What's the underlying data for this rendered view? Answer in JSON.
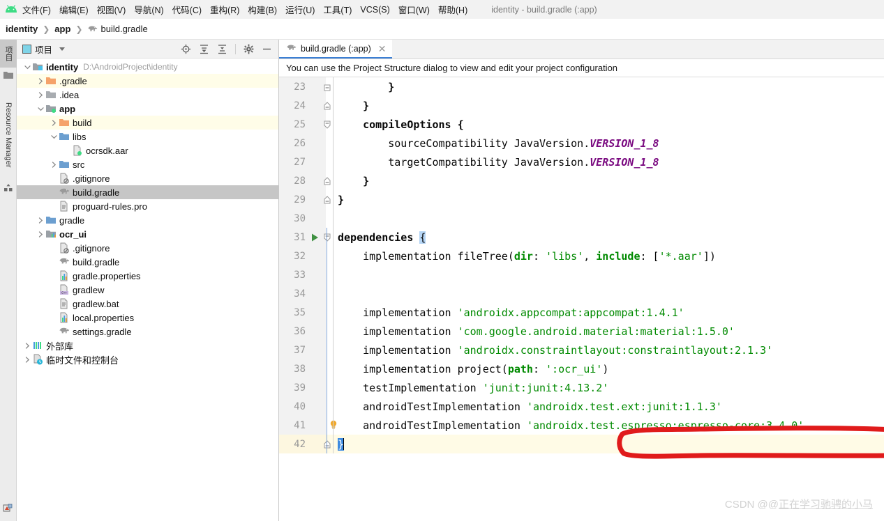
{
  "window": {
    "title": "identity - build.gradle (:app)",
    "accent_color": "#00b8cc"
  },
  "menubar": {
    "logo_icon": "android-logo-icon",
    "items": [
      {
        "label": "文件(F)",
        "name": "menu-file"
      },
      {
        "label": "编辑(E)",
        "name": "menu-edit"
      },
      {
        "label": "视图(V)",
        "name": "menu-view"
      },
      {
        "label": "导航(N)",
        "name": "menu-navigate"
      },
      {
        "label": "代码(C)",
        "name": "menu-code"
      },
      {
        "label": "重构(R)",
        "name": "menu-refactor"
      },
      {
        "label": "构建(B)",
        "name": "menu-build"
      },
      {
        "label": "运行(U)",
        "name": "menu-run"
      },
      {
        "label": "工具(T)",
        "name": "menu-tools"
      },
      {
        "label": "VCS(S)",
        "name": "menu-vcs"
      },
      {
        "label": "窗口(W)",
        "name": "menu-window"
      },
      {
        "label": "帮助(H)",
        "name": "menu-help"
      }
    ]
  },
  "breadcrumb": {
    "sep": "❯",
    "items": [
      {
        "label": "identity",
        "bold": true,
        "icon": ""
      },
      {
        "label": "app",
        "bold": true,
        "icon": ""
      },
      {
        "label": "build.gradle",
        "bold": false,
        "icon": "gradle-elephant-icon"
      }
    ]
  },
  "left_strip": {
    "project_label": "项目",
    "resource_manager_label": "Resource Manager",
    "project_icon": "folder-icon",
    "resource_icon": "resource-icon",
    "bottom_icon": "structure-icon"
  },
  "project_panel": {
    "title": "项目",
    "title_icon": "project-window-icon",
    "dropdown_icon": "chevron-down-icon",
    "tools": [
      {
        "name": "locate-file-icon",
        "label": "Select Opened File"
      },
      {
        "name": "expand-all-icon",
        "label": "Expand All"
      },
      {
        "name": "collapse-all-icon",
        "label": "Collapse All"
      },
      {
        "name": "settings-gear-icon",
        "label": "Settings"
      },
      {
        "name": "hide-panel-icon",
        "label": "Hide"
      }
    ],
    "tree": [
      {
        "label": "identity",
        "sublabel": "D:\\AndroidProject\\identity",
        "depth": 0,
        "arrow": "down",
        "icon": "module-icon",
        "bold": true,
        "state": "normal"
      },
      {
        "label": ".gradle",
        "sublabel": "",
        "depth": 1,
        "arrow": "right",
        "icon": "folder-orange-icon",
        "bold": false,
        "state": "excluded"
      },
      {
        "label": ".idea",
        "sublabel": "",
        "depth": 1,
        "arrow": "right",
        "icon": "folder-gray-icon",
        "bold": false,
        "state": "normal"
      },
      {
        "label": "app",
        "sublabel": "",
        "depth": 1,
        "arrow": "down",
        "icon": "module-android-icon",
        "bold": true,
        "state": "normal"
      },
      {
        "label": "build",
        "sublabel": "",
        "depth": 2,
        "arrow": "right",
        "icon": "folder-orange-icon",
        "bold": false,
        "state": "excluded"
      },
      {
        "label": "libs",
        "sublabel": "",
        "depth": 2,
        "arrow": "down",
        "icon": "folder-blue-icon",
        "bold": false,
        "state": "normal"
      },
      {
        "label": "ocrsdk.aar",
        "sublabel": "",
        "depth": 3,
        "arrow": "none",
        "icon": "aar-file-icon",
        "bold": false,
        "state": "normal"
      },
      {
        "label": "src",
        "sublabel": "",
        "depth": 2,
        "arrow": "right",
        "icon": "folder-blue-icon",
        "bold": false,
        "state": "normal"
      },
      {
        "label": ".gitignore",
        "sublabel": "",
        "depth": 2,
        "arrow": "none",
        "icon": "gitignore-file-icon",
        "bold": false,
        "state": "normal"
      },
      {
        "label": "build.gradle",
        "sublabel": "",
        "depth": 2,
        "arrow": "none",
        "icon": "gradle-elephant-icon",
        "bold": false,
        "state": "selected"
      },
      {
        "label": "proguard-rules.pro",
        "sublabel": "",
        "depth": 2,
        "arrow": "none",
        "icon": "text-file-icon",
        "bold": false,
        "state": "normal"
      },
      {
        "label": "gradle",
        "sublabel": "",
        "depth": 1,
        "arrow": "right",
        "icon": "folder-blue-icon",
        "bold": false,
        "state": "normal"
      },
      {
        "label": "ocr_ui",
        "sublabel": "",
        "depth": 1,
        "arrow": "right",
        "icon": "module-lib-icon",
        "bold": true,
        "state": "normal"
      },
      {
        "label": ".gitignore",
        "sublabel": "",
        "depth": 2,
        "arrow": "none",
        "icon": "gitignore-file-icon",
        "bold": false,
        "state": "normal"
      },
      {
        "label": "build.gradle",
        "sublabel": "",
        "depth": 2,
        "arrow": "none",
        "icon": "gradle-elephant-icon",
        "bold": false,
        "state": "normal"
      },
      {
        "label": "gradle.properties",
        "sublabel": "",
        "depth": 2,
        "arrow": "none",
        "icon": "properties-file-icon",
        "bold": false,
        "state": "normal"
      },
      {
        "label": "gradlew",
        "sublabel": "",
        "depth": 2,
        "arrow": "none",
        "icon": "cpp-file-icon",
        "bold": false,
        "state": "normal"
      },
      {
        "label": "gradlew.bat",
        "sublabel": "",
        "depth": 2,
        "arrow": "none",
        "icon": "text-file-icon",
        "bold": false,
        "state": "normal"
      },
      {
        "label": "local.properties",
        "sublabel": "",
        "depth": 2,
        "arrow": "none",
        "icon": "properties-file-icon",
        "bold": false,
        "state": "normal"
      },
      {
        "label": "settings.gradle",
        "sublabel": "",
        "depth": 2,
        "arrow": "none",
        "icon": "gradle-elephant-icon",
        "bold": false,
        "state": "normal"
      },
      {
        "label": "外部库",
        "sublabel": "",
        "depth": 0,
        "arrow": "right",
        "icon": "external-libraries-icon",
        "bold": false,
        "state": "normal"
      },
      {
        "label": "临时文件和控制台",
        "sublabel": "",
        "depth": 0,
        "arrow": "right",
        "icon": "scratches-icon",
        "bold": false,
        "state": "normal"
      }
    ]
  },
  "editor": {
    "tab": {
      "label": "build.gradle (:app)",
      "icon": "gradle-elephant-icon",
      "close": "✕"
    },
    "notification": "You can use the Project Structure dialog to view and edit your project configuration",
    "lines": [
      {
        "num": "23",
        "indent": 0,
        "fold": "end-top",
        "gutter_run": false,
        "bulb": false,
        "hl": false,
        "tokens": [
          {
            "t": "        }",
            "c": "kw"
          }
        ]
      },
      {
        "num": "24",
        "indent": 0,
        "fold": "end",
        "gutter_run": false,
        "bulb": false,
        "hl": false,
        "tokens": [
          {
            "t": "    }",
            "c": "kw"
          }
        ]
      },
      {
        "num": "25",
        "indent": 0,
        "fold": "start",
        "gutter_run": false,
        "bulb": false,
        "hl": false,
        "tokens": [
          {
            "t": "    compileOptions {",
            "c": "kw"
          }
        ]
      },
      {
        "num": "26",
        "indent": 0,
        "fold": "none",
        "gutter_run": false,
        "bulb": false,
        "hl": false,
        "tokens": [
          {
            "t": "        sourceCompatibility JavaVersion.",
            "c": "plain"
          },
          {
            "t": "VERSION_1_8",
            "c": "italicconst"
          }
        ]
      },
      {
        "num": "27",
        "indent": 0,
        "fold": "none",
        "gutter_run": false,
        "bulb": false,
        "hl": false,
        "tokens": [
          {
            "t": "        targetCompatibility JavaVersion.",
            "c": "plain"
          },
          {
            "t": "VERSION_1_8",
            "c": "italicconst"
          }
        ]
      },
      {
        "num": "28",
        "indent": 0,
        "fold": "end",
        "gutter_run": false,
        "bulb": false,
        "hl": false,
        "tokens": [
          {
            "t": "    }",
            "c": "kw"
          }
        ]
      },
      {
        "num": "29",
        "indent": 0,
        "fold": "end",
        "gutter_run": false,
        "bulb": false,
        "hl": false,
        "tokens": [
          {
            "t": "}",
            "c": "kw"
          }
        ]
      },
      {
        "num": "30",
        "indent": 0,
        "fold": "none",
        "gutter_run": false,
        "bulb": false,
        "hl": false,
        "tokens": []
      },
      {
        "num": "31",
        "indent": 0,
        "fold": "start",
        "gutter_run": true,
        "bulb": false,
        "hl": false,
        "tokens": [
          {
            "t": "dependencies ",
            "c": "kw"
          },
          {
            "t": "{",
            "c": "hlbrace"
          }
        ]
      },
      {
        "num": "32",
        "indent": 0,
        "fold": "none",
        "gutter_run": false,
        "bulb": false,
        "hl": false,
        "tokens": [
          {
            "t": "    implementation fileTree(",
            "c": "plain"
          },
          {
            "t": "dir",
            "c": "named"
          },
          {
            "t": ": ",
            "c": "plain"
          },
          {
            "t": "'libs'",
            "c": "str"
          },
          {
            "t": ", ",
            "c": "plain"
          },
          {
            "t": "include",
            "c": "named"
          },
          {
            "t": ": [",
            "c": "plain"
          },
          {
            "t": "'*.aar'",
            "c": "str"
          },
          {
            "t": "])",
            "c": "plain"
          }
        ]
      },
      {
        "num": "33",
        "indent": 0,
        "fold": "none",
        "gutter_run": false,
        "bulb": false,
        "hl": false,
        "tokens": []
      },
      {
        "num": "34",
        "indent": 0,
        "fold": "none",
        "gutter_run": false,
        "bulb": false,
        "hl": false,
        "tokens": []
      },
      {
        "num": "35",
        "indent": 0,
        "fold": "none",
        "gutter_run": false,
        "bulb": false,
        "hl": false,
        "tokens": [
          {
            "t": "    implementation ",
            "c": "plain"
          },
          {
            "t": "'androidx.appcompat:appcompat:1.4.1'",
            "c": "str"
          }
        ]
      },
      {
        "num": "36",
        "indent": 0,
        "fold": "none",
        "gutter_run": false,
        "bulb": false,
        "hl": false,
        "tokens": [
          {
            "t": "    implementation ",
            "c": "plain"
          },
          {
            "t": "'com.google.android.material:material:1.5.0'",
            "c": "str"
          }
        ]
      },
      {
        "num": "37",
        "indent": 0,
        "fold": "none",
        "gutter_run": false,
        "bulb": false,
        "hl": false,
        "tokens": [
          {
            "t": "    implementation ",
            "c": "plain"
          },
          {
            "t": "'androidx.constraintlayout:constraintlayout:2.1.3'",
            "c": "str"
          }
        ]
      },
      {
        "num": "38",
        "indent": 0,
        "fold": "none",
        "gutter_run": false,
        "bulb": false,
        "hl": false,
        "tokens": [
          {
            "t": "    implementation project(",
            "c": "plain"
          },
          {
            "t": "path",
            "c": "named"
          },
          {
            "t": ": ",
            "c": "plain"
          },
          {
            "t": "':ocr_ui'",
            "c": "str"
          },
          {
            "t": ")",
            "c": "plain"
          }
        ]
      },
      {
        "num": "39",
        "indent": 0,
        "fold": "none",
        "gutter_run": false,
        "bulb": false,
        "hl": false,
        "tokens": [
          {
            "t": "    testImplementation ",
            "c": "plain"
          },
          {
            "t": "'junit:junit:4.13.2'",
            "c": "str"
          }
        ]
      },
      {
        "num": "40",
        "indent": 0,
        "fold": "none",
        "gutter_run": false,
        "bulb": false,
        "hl": false,
        "tokens": [
          {
            "t": "    androidTestImplementation ",
            "c": "plain"
          },
          {
            "t": "'androidx.test.ext:junit:1.1.3'",
            "c": "str"
          }
        ]
      },
      {
        "num": "41",
        "indent": 0,
        "fold": "none",
        "gutter_run": false,
        "bulb": true,
        "hl": false,
        "tokens": [
          {
            "t": "    androidTestImplementation ",
            "c": "plain"
          },
          {
            "t": "'androidx.test.espresso:espresso-core:3.4.0'",
            "c": "str"
          }
        ]
      },
      {
        "num": "42",
        "indent": 0,
        "fold": "end",
        "gutter_run": false,
        "bulb": false,
        "hl": true,
        "tokens": [
          {
            "t": "}",
            "c": "cursor-sel"
          }
        ]
      }
    ]
  },
  "annotation": {
    "name": "red-highlight-circle",
    "color": "#e01b1b",
    "target_line": "38"
  },
  "watermark": {
    "prefix": "CSDN @@",
    "user": "正在学习驰骋的小马"
  }
}
